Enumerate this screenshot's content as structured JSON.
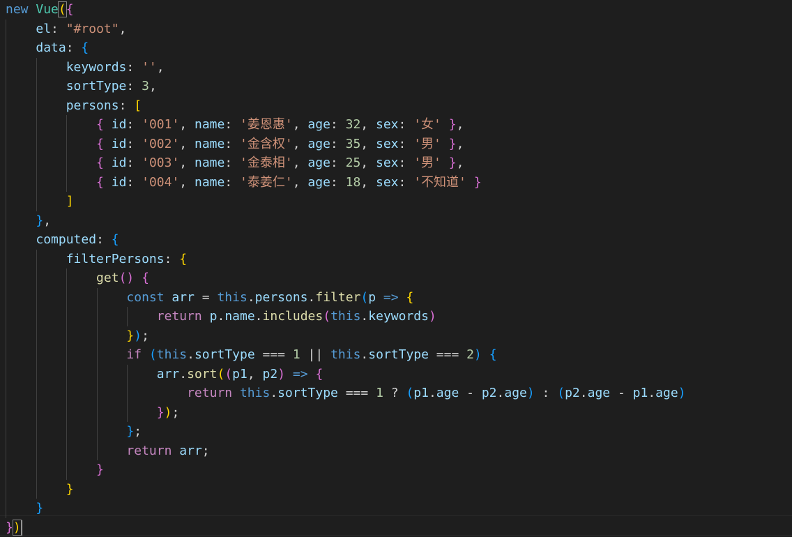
{
  "lines": [
    [
      [
        "kw",
        "new"
      ],
      [
        "p",
        " "
      ],
      [
        "class",
        "Vue"
      ],
      [
        "b1",
        "("
      ],
      [
        "b2",
        "{"
      ]
    ],
    [
      [
        "p",
        "    "
      ],
      [
        "prop",
        "el"
      ],
      [
        "p",
        ": "
      ],
      [
        "str",
        "\"#root\""
      ],
      [
        "p",
        ","
      ]
    ],
    [
      [
        "p",
        "    "
      ],
      [
        "prop",
        "data"
      ],
      [
        "p",
        ": "
      ],
      [
        "b3",
        "{"
      ]
    ],
    [
      [
        "p",
        "        "
      ],
      [
        "prop",
        "keywords"
      ],
      [
        "p",
        ": "
      ],
      [
        "str",
        "''"
      ],
      [
        "p",
        ","
      ]
    ],
    [
      [
        "p",
        "        "
      ],
      [
        "prop",
        "sortType"
      ],
      [
        "p",
        ": "
      ],
      [
        "num",
        "3"
      ],
      [
        "p",
        ","
      ]
    ],
    [
      [
        "p",
        "        "
      ],
      [
        "prop",
        "persons"
      ],
      [
        "p",
        ": "
      ],
      [
        "b1",
        "["
      ]
    ],
    [
      [
        "p",
        "            "
      ],
      [
        "b2",
        "{"
      ],
      [
        "p",
        " "
      ],
      [
        "prop",
        "id"
      ],
      [
        "p",
        ": "
      ],
      [
        "str",
        "'001'"
      ],
      [
        "p",
        ", "
      ],
      [
        "prop",
        "name"
      ],
      [
        "p",
        ": "
      ],
      [
        "str",
        "'姜恩惠'"
      ],
      [
        "p",
        ", "
      ],
      [
        "prop",
        "age"
      ],
      [
        "p",
        ": "
      ],
      [
        "num",
        "32"
      ],
      [
        "p",
        ", "
      ],
      [
        "prop",
        "sex"
      ],
      [
        "p",
        ": "
      ],
      [
        "str",
        "'女'"
      ],
      [
        "p",
        " "
      ],
      [
        "b2",
        "}"
      ],
      [
        "p",
        ","
      ]
    ],
    [
      [
        "p",
        "            "
      ],
      [
        "b2",
        "{"
      ],
      [
        "p",
        " "
      ],
      [
        "prop",
        "id"
      ],
      [
        "p",
        ": "
      ],
      [
        "str",
        "'002'"
      ],
      [
        "p",
        ", "
      ],
      [
        "prop",
        "name"
      ],
      [
        "p",
        ": "
      ],
      [
        "str",
        "'金含权'"
      ],
      [
        "p",
        ", "
      ],
      [
        "prop",
        "age"
      ],
      [
        "p",
        ": "
      ],
      [
        "num",
        "35"
      ],
      [
        "p",
        ", "
      ],
      [
        "prop",
        "sex"
      ],
      [
        "p",
        ": "
      ],
      [
        "str",
        "'男'"
      ],
      [
        "p",
        " "
      ],
      [
        "b2",
        "}"
      ],
      [
        "p",
        ","
      ]
    ],
    [
      [
        "p",
        "            "
      ],
      [
        "b2",
        "{"
      ],
      [
        "p",
        " "
      ],
      [
        "prop",
        "id"
      ],
      [
        "p",
        ": "
      ],
      [
        "str",
        "'003'"
      ],
      [
        "p",
        ", "
      ],
      [
        "prop",
        "name"
      ],
      [
        "p",
        ": "
      ],
      [
        "str",
        "'金泰相'"
      ],
      [
        "p",
        ", "
      ],
      [
        "prop",
        "age"
      ],
      [
        "p",
        ": "
      ],
      [
        "num",
        "25"
      ],
      [
        "p",
        ", "
      ],
      [
        "prop",
        "sex"
      ],
      [
        "p",
        ": "
      ],
      [
        "str",
        "'男'"
      ],
      [
        "p",
        " "
      ],
      [
        "b2",
        "}"
      ],
      [
        "p",
        ","
      ]
    ],
    [
      [
        "p",
        "            "
      ],
      [
        "b2",
        "{"
      ],
      [
        "p",
        " "
      ],
      [
        "prop",
        "id"
      ],
      [
        "p",
        ": "
      ],
      [
        "str",
        "'004'"
      ],
      [
        "p",
        ", "
      ],
      [
        "prop",
        "name"
      ],
      [
        "p",
        ": "
      ],
      [
        "str",
        "'泰姜仁'"
      ],
      [
        "p",
        ", "
      ],
      [
        "prop",
        "age"
      ],
      [
        "p",
        ": "
      ],
      [
        "num",
        "18"
      ],
      [
        "p",
        ", "
      ],
      [
        "prop",
        "sex"
      ],
      [
        "p",
        ": "
      ],
      [
        "str",
        "'不知道'"
      ],
      [
        "p",
        " "
      ],
      [
        "b2",
        "}"
      ]
    ],
    [
      [
        "p",
        "        "
      ],
      [
        "b1",
        "]"
      ]
    ],
    [
      [
        "p",
        "    "
      ],
      [
        "b3",
        "}"
      ],
      [
        "p",
        ","
      ]
    ],
    [
      [
        "p",
        "    "
      ],
      [
        "prop",
        "computed"
      ],
      [
        "p",
        ": "
      ],
      [
        "b3",
        "{"
      ]
    ],
    [
      [
        "p",
        "        "
      ],
      [
        "prop",
        "filterPersons"
      ],
      [
        "p",
        ": "
      ],
      [
        "b1",
        "{"
      ]
    ],
    [
      [
        "p",
        "            "
      ],
      [
        "func",
        "get"
      ],
      [
        "b2",
        "()"
      ],
      [
        "p",
        " "
      ],
      [
        "b2",
        "{"
      ]
    ],
    [
      [
        "p",
        "                "
      ],
      [
        "kw",
        "const"
      ],
      [
        "p",
        " "
      ],
      [
        "prop",
        "arr"
      ],
      [
        "p",
        " = "
      ],
      [
        "kw",
        "this"
      ],
      [
        "p",
        "."
      ],
      [
        "prop",
        "persons"
      ],
      [
        "p",
        "."
      ],
      [
        "func",
        "filter"
      ],
      [
        "b3",
        "("
      ],
      [
        "prop",
        "p"
      ],
      [
        "p",
        " "
      ],
      [
        "kw",
        "=>"
      ],
      [
        "p",
        " "
      ],
      [
        "b1",
        "{"
      ]
    ],
    [
      [
        "p",
        "                    "
      ],
      [
        "ctrl",
        "return"
      ],
      [
        "p",
        " "
      ],
      [
        "prop",
        "p"
      ],
      [
        "p",
        "."
      ],
      [
        "prop",
        "name"
      ],
      [
        "p",
        "."
      ],
      [
        "func",
        "includes"
      ],
      [
        "b2",
        "("
      ],
      [
        "kw",
        "this"
      ],
      [
        "p",
        "."
      ],
      [
        "prop",
        "keywords"
      ],
      [
        "b2",
        ")"
      ]
    ],
    [
      [
        "p",
        "                "
      ],
      [
        "b1",
        "}"
      ],
      [
        "b3",
        ")"
      ],
      [
        "p",
        ";"
      ]
    ],
    [
      [
        "p",
        "                "
      ],
      [
        "ctrl",
        "if"
      ],
      [
        "p",
        " "
      ],
      [
        "b3",
        "("
      ],
      [
        "kw",
        "this"
      ],
      [
        "p",
        "."
      ],
      [
        "prop",
        "sortType"
      ],
      [
        "p",
        " === "
      ],
      [
        "num",
        "1"
      ],
      [
        "p",
        " || "
      ],
      [
        "kw",
        "this"
      ],
      [
        "p",
        "."
      ],
      [
        "prop",
        "sortType"
      ],
      [
        "p",
        " === "
      ],
      [
        "num",
        "2"
      ],
      [
        "b3",
        ")"
      ],
      [
        "p",
        " "
      ],
      [
        "b3",
        "{"
      ]
    ],
    [
      [
        "p",
        "                    "
      ],
      [
        "prop",
        "arr"
      ],
      [
        "p",
        "."
      ],
      [
        "func",
        "sort"
      ],
      [
        "b1",
        "("
      ],
      [
        "b2",
        "("
      ],
      [
        "prop",
        "p1"
      ],
      [
        "p",
        ", "
      ],
      [
        "prop",
        "p2"
      ],
      [
        "b2",
        ")"
      ],
      [
        "p",
        " "
      ],
      [
        "kw",
        "=>"
      ],
      [
        "p",
        " "
      ],
      [
        "b2",
        "{"
      ]
    ],
    [
      [
        "p",
        "                        "
      ],
      [
        "ctrl",
        "return"
      ],
      [
        "p",
        " "
      ],
      [
        "kw",
        "this"
      ],
      [
        "p",
        "."
      ],
      [
        "prop",
        "sortType"
      ],
      [
        "p",
        " === "
      ],
      [
        "num",
        "1"
      ],
      [
        "p",
        " ? "
      ],
      [
        "b3",
        "("
      ],
      [
        "prop",
        "p1"
      ],
      [
        "p",
        "."
      ],
      [
        "prop",
        "age"
      ],
      [
        "p",
        " - "
      ],
      [
        "prop",
        "p2"
      ],
      [
        "p",
        "."
      ],
      [
        "prop",
        "age"
      ],
      [
        "b3",
        ")"
      ],
      [
        "p",
        " : "
      ],
      [
        "b3",
        "("
      ],
      [
        "prop",
        "p2"
      ],
      [
        "p",
        "."
      ],
      [
        "prop",
        "age"
      ],
      [
        "p",
        " - "
      ],
      [
        "prop",
        "p1"
      ],
      [
        "p",
        "."
      ],
      [
        "prop",
        "age"
      ],
      [
        "b3",
        ")"
      ]
    ],
    [
      [
        "p",
        "                    "
      ],
      [
        "b2",
        "}"
      ],
      [
        "b1",
        ")"
      ],
      [
        "p",
        ";"
      ]
    ],
    [
      [
        "p",
        "                "
      ],
      [
        "b3",
        "}"
      ],
      [
        "p",
        ";"
      ]
    ],
    [
      [
        "p",
        "                "
      ],
      [
        "ctrl",
        "return"
      ],
      [
        "p",
        " "
      ],
      [
        "prop",
        "arr"
      ],
      [
        "p",
        ";"
      ]
    ],
    [
      [
        "p",
        "            "
      ],
      [
        "b2",
        "}"
      ]
    ],
    [
      [
        "p",
        "        "
      ],
      [
        "b1",
        "}"
      ]
    ],
    [
      [
        "p",
        "    "
      ],
      [
        "b3",
        "}"
      ]
    ],
    [
      [
        "b2",
        "}"
      ],
      [
        "b1",
        ")"
      ]
    ]
  ]
}
